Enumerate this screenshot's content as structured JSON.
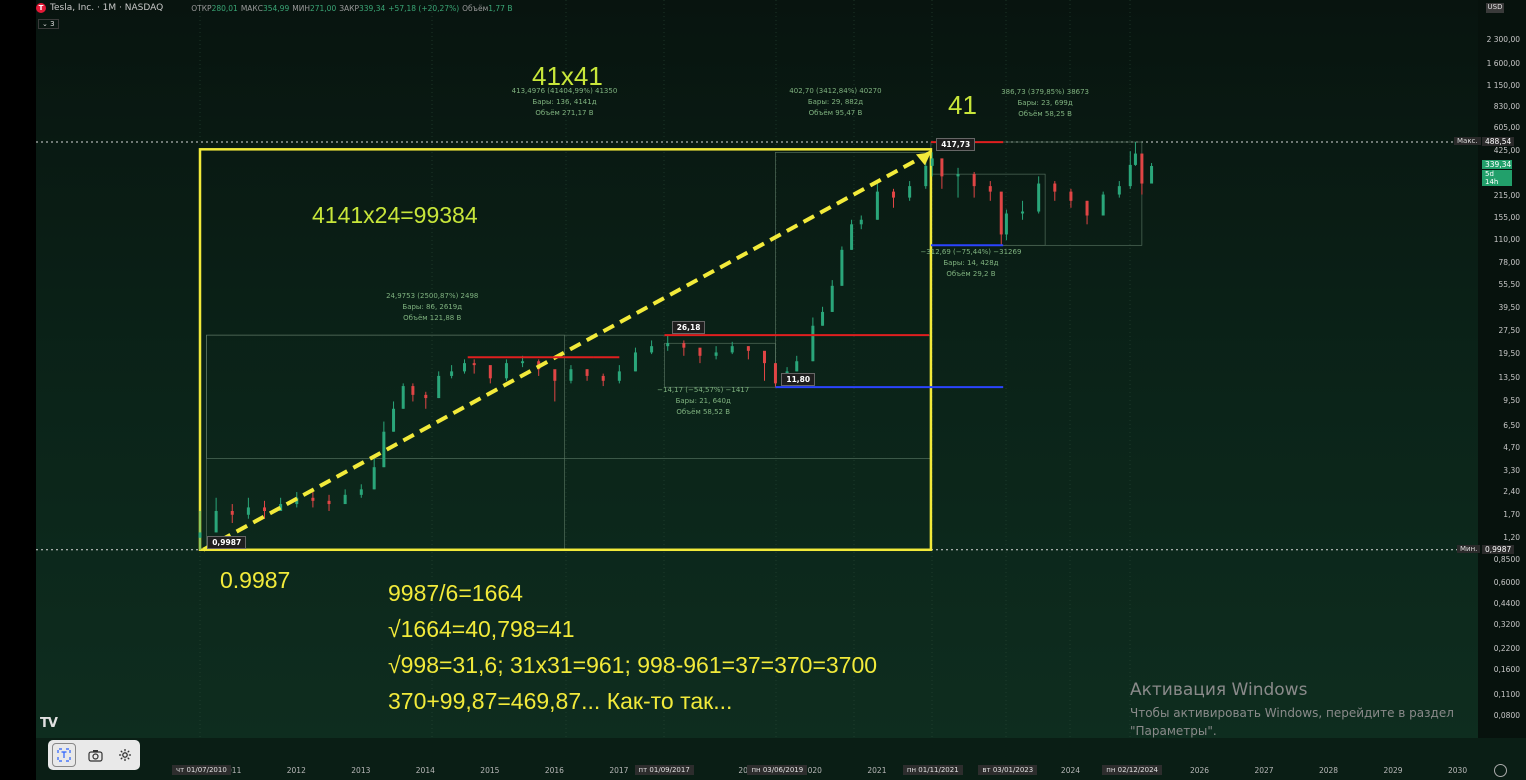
{
  "header": {
    "symbol_letter": "T",
    "title": "Tesla, Inc. · 1M · NASDAQ",
    "ohlc": [
      {
        "label": "ОТКР",
        "value": "280,01"
      },
      {
        "label": "МАКС",
        "value": "354,99"
      },
      {
        "label": "МИН",
        "value": "271,00"
      },
      {
        "label": "ЗАКР",
        "value": "339,34"
      },
      {
        "label": "",
        "value": "+57,18 (+20,27%)"
      },
      {
        "label": "Объём",
        "value": "1,77 B"
      }
    ],
    "indicator_count": "3",
    "currency": "USD"
  },
  "colors": {
    "background": "#000000",
    "annotation_yellow": "#f2ea3a",
    "annotation_green": "#c8e63a",
    "up_candle": "#2aa67a",
    "down_candle": "#e04545",
    "support_blue": "#2b44ff",
    "resistance_red": "#e01f1f"
  },
  "chart_data": {
    "type": "candlestick",
    "scale": "log",
    "ylim": [
      0.08,
      3000
    ],
    "xlim": [
      2010.5,
      2030.5
    ],
    "title": "Tesla, Inc. · 1M · NASDAQ",
    "price_ticks": [
      "2 300,00",
      "1 600,00",
      "1 150,00",
      "830,00",
      "605,00",
      "425,00",
      "215,00",
      "155,00",
      "110,00",
      "78,00",
      "55,50",
      "39,50",
      "27,50",
      "19,50",
      "13,50",
      "9,50",
      "6,50",
      "4,70",
      "3,30",
      "2,40",
      "1,70",
      "1,20",
      "0,8500",
      "0,6000",
      "0,4400",
      "0,3200",
      "0,2200",
      "0,1600",
      "0,1100",
      "0,0800"
    ],
    "price_tick_values": [
      2300,
      1600,
      1150,
      830,
      605,
      425,
      215,
      155,
      110,
      78,
      55.5,
      39.5,
      27.5,
      19.5,
      13.5,
      9.5,
      6.5,
      4.7,
      3.3,
      2.4,
      1.7,
      1.2,
      0.85,
      0.6,
      0.44,
      0.32,
      0.22,
      0.16,
      0.11,
      0.08
    ],
    "year_ticks": [
      2011,
      2012,
      2013,
      2014,
      2015,
      2016,
      2017,
      2018,
      2019,
      2020,
      2021,
      2022,
      2023,
      2024,
      2025,
      2026,
      2027,
      2028,
      2029,
      2030
    ],
    "year_labels": [
      "2011",
      "2012",
      "2013",
      "2014",
      "2015",
      "2016",
      "2017",
      "2018",
      "2019",
      "2020",
      "2021",
      "2022",
      "2023",
      "2024",
      "2025",
      "2026",
      "2027",
      "2028",
      "2029",
      "2030"
    ],
    "date_flags": [
      {
        "label": "чт 01/07/2010",
        "t": 2010.5
      },
      {
        "label": "пт 01/09/2017",
        "t": 2017.67
      },
      {
        "label": "пн 03/06/2019",
        "t": 2019.42
      },
      {
        "label": "пн 01/11/2021",
        "t": 2021.83
      },
      {
        "label": "вт 03/01/2023",
        "t": 2023.0
      },
      {
        "label": "пн 02/12/2024",
        "t": 2024.92
      }
    ],
    "right_markers": [
      {
        "label": "Макс.",
        "value": "488,54",
        "price": 488.54
      },
      {
        "label": "",
        "value": "339,34",
        "price": 339.34
      },
      {
        "label": "",
        "value": "5d 14h",
        "price": 300
      },
      {
        "label": "Мин.",
        "value": "0,9987",
        "price": 0.9987
      }
    ],
    "point_labels": [
      {
        "text": "0,9987",
        "t": 2010.55,
        "price": 0.9987
      },
      {
        "text": "26,18",
        "t": 2017.75,
        "price": 26.18
      },
      {
        "text": "11,80",
        "t": 2019.45,
        "price": 11.8
      },
      {
        "text": "417,73",
        "t": 2021.85,
        "price": 417.73
      }
    ],
    "measure_stats": [
      {
        "lines": [
          "413,4976 (41404,99%) 41350",
          "Бары: 136, 4141д",
          "Объём 271,17 B"
        ],
        "t": 2016.15,
        "price": 900
      },
      {
        "lines": [
          "24,9753 (2500,87%) 2498",
          "Бары: 86, 2619д",
          "Объём 121,88 B"
        ],
        "t": 2014.1,
        "price": 40
      },
      {
        "lines": [
          "402,70 (3412,84%) 40270",
          "Бары: 29, 882д",
          "Объём 95,47 B"
        ],
        "t": 2020.35,
        "price": 900
      },
      {
        "lines": [
          "−14,17 (−54,57%) −1417",
          "Бары: 21, 640д",
          "Объём 58,52 B"
        ],
        "t": 2018.3,
        "price": 9.5
      },
      {
        "lines": [
          "386,73 (379,85%) 38673",
          "Бары: 23, 699д",
          "Объём 58,25 B"
        ],
        "t": 2023.6,
        "price": 880
      },
      {
        "lines": [
          "−312,69 (−75,44%) −31269",
          "Бары: 14, 428д",
          "Объём 29,2 B"
        ],
        "t": 2022.45,
        "price": 78
      }
    ],
    "series": [
      {
        "name": "",
        "t": [
          2010.5,
          2010.75,
          2011.0,
          2011.25,
          2011.5,
          2011.75,
          2012.0,
          2012.25,
          2012.5,
          2012.75,
          2013.0,
          2013.2,
          2013.35,
          2013.5,
          2013.65,
          2013.8,
          2014.0,
          2014.2,
          2014.4,
          2014.6,
          2014.75,
          2015.0,
          2015.25,
          2015.5,
          2015.75,
          2016.0,
          2016.25,
          2016.5,
          2016.75,
          2017.0,
          2017.25,
          2017.5,
          2017.75,
          2018.0,
          2018.25,
          2018.5,
          2018.75,
          2019.0,
          2019.25,
          2019.42,
          2019.6,
          2019.75,
          2020.0,
          2020.15,
          2020.3,
          2020.45,
          2020.6,
          2020.75,
          2021.0,
          2021.25,
          2021.5,
          2021.75,
          2021.85,
          2022.0,
          2022.25,
          2022.5,
          2022.75,
          2022.92,
          2023.0,
          2023.25,
          2023.5,
          2023.75,
          2024.0,
          2024.25,
          2024.5,
          2024.75,
          2024.92,
          2025.0,
          2025.1,
          2025.25
        ],
        "close": [
          1.3,
          1.8,
          1.7,
          1.9,
          1.8,
          2.0,
          2.2,
          2.1,
          2.0,
          2.3,
          2.5,
          3.5,
          6.0,
          8.5,
          12.0,
          10.5,
          10.0,
          14.0,
          15.0,
          17.0,
          16.5,
          13.5,
          17.0,
          17.5,
          15.5,
          13.0,
          15.5,
          14.0,
          13.0,
          15.0,
          20.0,
          22.0,
          23.0,
          21.5,
          19.0,
          20.0,
          22.0,
          20.5,
          17.0,
          12.5,
          15.0,
          17.5,
          30.0,
          37.0,
          55.0,
          95.0,
          140.0,
          150.0,
          230.0,
          210.0,
          250.0,
          340.0,
          381.0,
          290.0,
          300.0,
          250.0,
          230.0,
          120.0,
          165.0,
          170.0,
          260.0,
          230.0,
          200.0,
          160.0,
          220.0,
          250.0,
          345.0,
          410.0,
          260.0,
          339.34
        ],
        "high": [
          1.8,
          2.2,
          2.0,
          2.2,
          2.1,
          2.2,
          2.4,
          2.4,
          2.3,
          2.5,
          2.7,
          4.2,
          7.0,
          9.5,
          12.5,
          12.5,
          11.0,
          15.0,
          16.5,
          18.0,
          18.0,
          15.5,
          18.0,
          19.0,
          18.0,
          15.0,
          16.5,
          15.5,
          14.5,
          16.5,
          21.5,
          24.0,
          26.18,
          24.0,
          21.0,
          22.0,
          23.5,
          22.0,
          19.0,
          14.0,
          16.0,
          19.0,
          34.0,
          40.0,
          60.0,
          100.0,
          150.0,
          160.0,
          260.0,
          240.0,
          270.0,
          380.0,
          417.73,
          350.0,
          330.0,
          310.0,
          270.0,
          180.0,
          175.0,
          200.0,
          290.0,
          270.0,
          240.0,
          200.0,
          230.0,
          270.0,
          425.0,
          488.54,
          380.0,
          354.99
        ],
        "low": [
          0.9987,
          1.3,
          1.5,
          1.6,
          1.6,
          1.8,
          1.9,
          1.9,
          1.8,
          2.0,
          2.2,
          2.5,
          3.5,
          6.0,
          8.5,
          9.5,
          8.5,
          10.0,
          13.5,
          14.5,
          14.5,
          12.5,
          13.0,
          16.0,
          14.0,
          9.5,
          12.5,
          13.0,
          12.0,
          12.5,
          15.0,
          19.5,
          20.5,
          19.0,
          17.0,
          18.0,
          19.5,
          18.0,
          13.0,
          11.8,
          12.0,
          15.0,
          17.5,
          30.0,
          37.0,
          55.0,
          95.0,
          130.0,
          150.0,
          180.0,
          200.0,
          240.0,
          290.0,
          240.0,
          210.0,
          210.0,
          200.0,
          101.81,
          110.0,
          150.0,
          165.0,
          200.0,
          180.0,
          140.0,
          160.0,
          210.0,
          240.0,
          340.0,
          220.0,
          271.0
        ]
      }
    ],
    "overlay_lines": [
      {
        "color": "yellow",
        "style": "dashed",
        "from": {
          "t": 2010.55,
          "price": 0.9987
        },
        "to": {
          "t": 2021.83,
          "price": 417.73
        }
      },
      {
        "color": "red",
        "from": {
          "t": 2014.65,
          "price": 18.6
        },
        "to": {
          "t": 2016.6,
          "price": 18.6
        }
      },
      {
        "color": "red",
        "from": {
          "t": 2016.6,
          "price": 18.6
        },
        "to": {
          "t": 2017.0,
          "price": 18.6
        }
      },
      {
        "color": "red",
        "from": {
          "t": 2017.7,
          "price": 26.0
        },
        "to": {
          "t": 2021.8,
          "price": 26.0
        }
      },
      {
        "color": "blue",
        "from": {
          "t": 2019.42,
          "price": 11.8
        },
        "to": {
          "t": 2022.95,
          "price": 11.8
        }
      },
      {
        "color": "red",
        "from": {
          "t": 2021.83,
          "price": 488.0
        },
        "to": {
          "t": 2022.95,
          "price": 488.0
        }
      },
      {
        "color": "blue",
        "from": {
          "t": 2021.83,
          "price": 101.81
        },
        "to": {
          "t": 2022.95,
          "price": 101.81
        }
      }
    ],
    "price_lines": [
      488.54,
      0.9987
    ]
  },
  "annotations": {
    "a41x41": "41x41",
    "a41": "41",
    "formula": "4141x24=99384",
    "low_price": "0.9987",
    "notes": [
      "9987/6=1664",
      "√1664=40,798=41",
      "√998=31,6; 31x31=961; 998-961=37=370=3700",
      "370+99,87=469,87... Как-то так..."
    ]
  },
  "windows_activation": {
    "title": "Активация Windows",
    "line1": "Чтобы активировать Windows, перейдите в раздел",
    "line2": "\"Параметры\"."
  },
  "toolbar": {
    "tools": [
      "text-select-icon",
      "camera-icon",
      "gear-icon"
    ]
  },
  "branding": "TV",
  "clock_icon": "clock-icon"
}
